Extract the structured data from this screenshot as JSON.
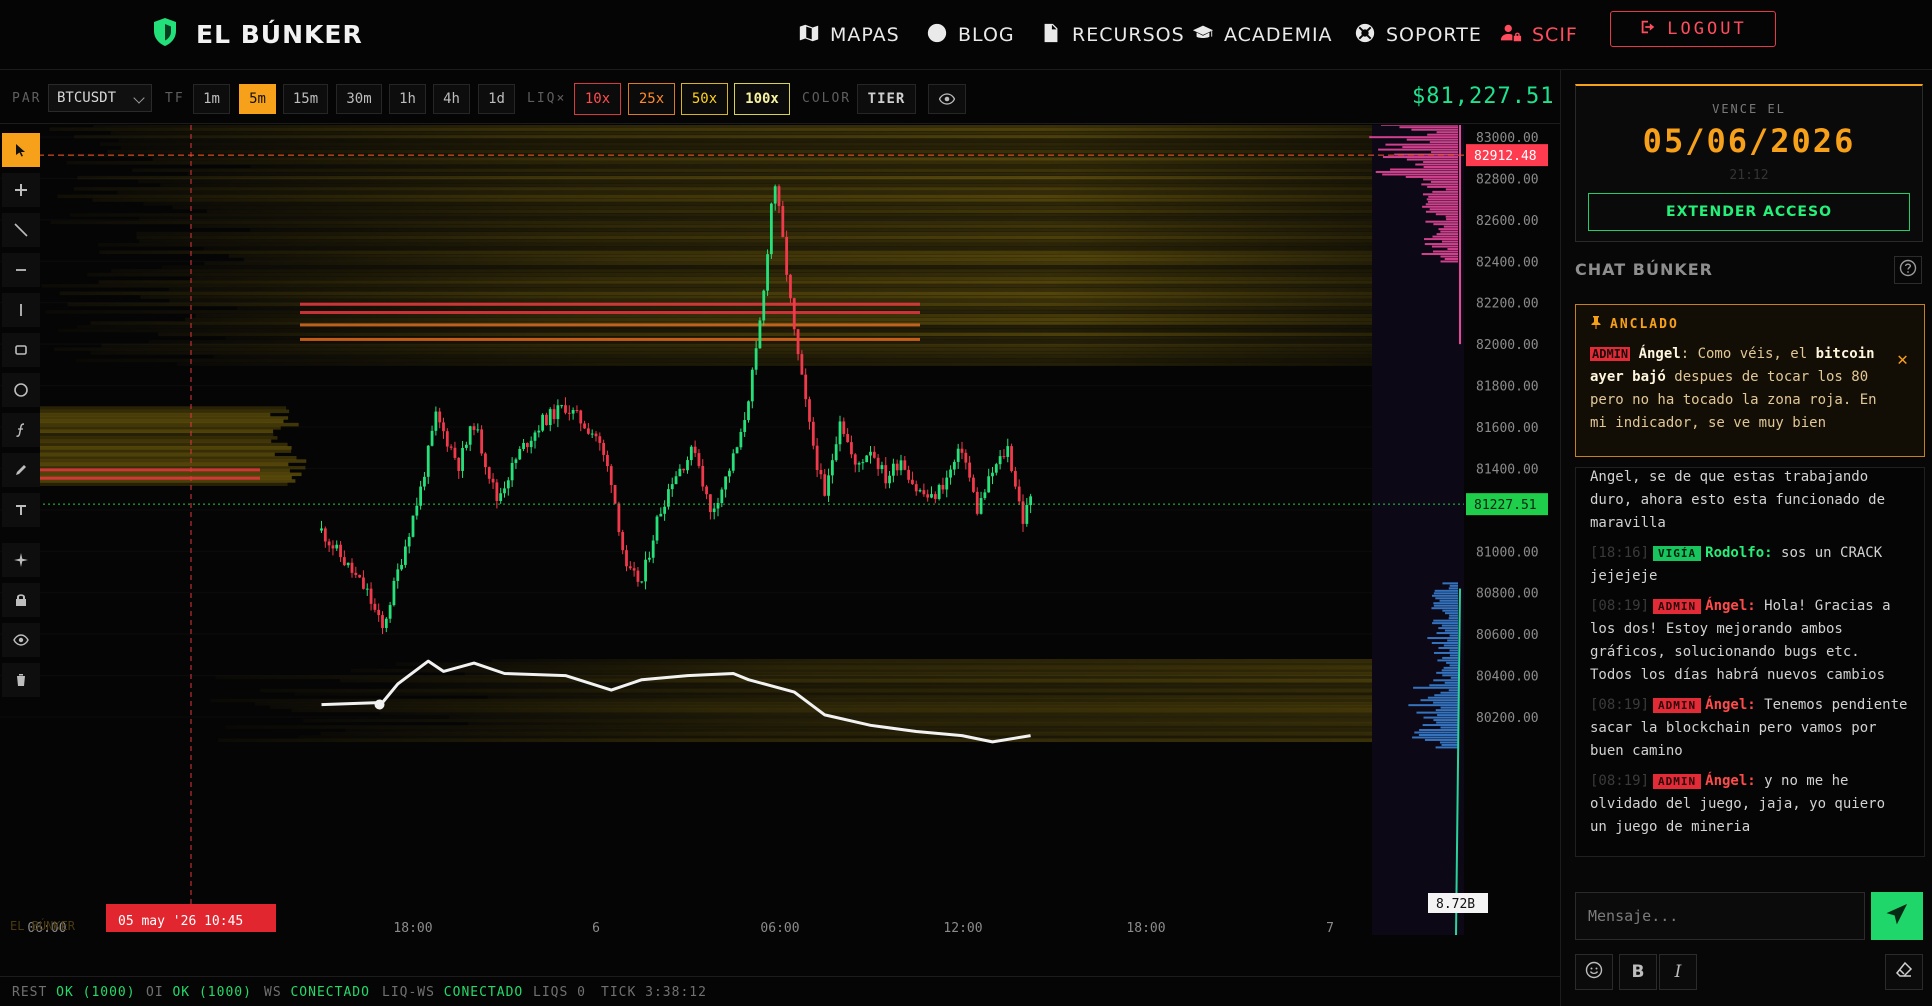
{
  "header": {
    "brand": "EL BÚNKER",
    "nav": [
      {
        "label": "MAPAS",
        "icon": "map-icon"
      },
      {
        "label": "BLOG",
        "icon": "globe-icon"
      },
      {
        "label": "RECURSOS",
        "icon": "document-icon"
      },
      {
        "label": "ACADEMIA",
        "icon": "graduation-cap-icon"
      },
      {
        "label": "SOPORTE",
        "icon": "lifebuoy-icon"
      },
      {
        "label": "SCIF",
        "icon": "user-lock-icon"
      }
    ],
    "logout": "LOGOUT"
  },
  "toolbar": {
    "pair_label": "PAR",
    "pair_value": "BTCUSDT",
    "tf_label": "TF",
    "timeframes": [
      "1m",
      "5m",
      "15m",
      "30m",
      "1h",
      "4h",
      "1d"
    ],
    "active_timeframe": "5m",
    "liq_label": "LIQ×",
    "leverages": [
      "10x",
      "25x",
      "50x",
      "100x"
    ],
    "color_label": "COLOR",
    "tier_label": "TIER",
    "last_price": "$81,227.51"
  },
  "chart_data": {
    "type": "candlestick",
    "symbol": "BTCUSDT",
    "timeframe": "5m",
    "ylim": [
      80100,
      83150
    ],
    "y_ticks": [
      "83000.00",
      "82800.00",
      "82600.00",
      "82400.00",
      "82200.00",
      "82000.00",
      "81800.00",
      "81600.00",
      "81400.00",
      "81200.00",
      "81000.00",
      "80800.00",
      "80600.00",
      "80400.00",
      "80200.00"
    ],
    "x_ticks": [
      "06:00",
      "18:00",
      "6",
      "06:00",
      "12:00",
      "18:00",
      "7"
    ],
    "cursor_label": "05 may '26   10:45",
    "current_price_label": "81227.51",
    "current_price": 81227.51,
    "high_marker_label": "82912.48",
    "high_marker": 82912.48,
    "volume_label": "8.72B",
    "watermark": "EL BÚNKER",
    "close_path": [
      [
        "05 06:00",
        81100
      ],
      [
        "05 07:30",
        80950
      ],
      [
        "05 09:00",
        80800
      ],
      [
        "05 10:00",
        80620
      ],
      [
        "05 11:00",
        80900
      ],
      [
        "05 12:30",
        81300
      ],
      [
        "05 13:30",
        81650
      ],
      [
        "05 15:00",
        81420
      ],
      [
        "05 16:00",
        81620
      ],
      [
        "05 17:30",
        81250
      ],
      [
        "05 19:00",
        81480
      ],
      [
        "05 20:30",
        81630
      ],
      [
        "05 22:00",
        81700
      ],
      [
        "06 00:00",
        81560
      ],
      [
        "06 01:00",
        81350
      ],
      [
        "06 02:00",
        80900
      ],
      [
        "06 03:00",
        80850
      ],
      [
        "06 04:00",
        81150
      ],
      [
        "06 05:00",
        81350
      ],
      [
        "06 06:30",
        81500
      ],
      [
        "06 07:30",
        81180
      ],
      [
        "06 08:30",
        81350
      ],
      [
        "06 09:30",
        81550
      ],
      [
        "06 10:30",
        81950
      ],
      [
        "06 11:00",
        82250
      ],
      [
        "06 11:40",
        82820
      ],
      [
        "06 12:20",
        82450
      ],
      [
        "06 13:00",
        82050
      ],
      [
        "06 14:00",
        81600
      ],
      [
        "06 15:00",
        81250
      ],
      [
        "06 16:00",
        81650
      ],
      [
        "06 17:00",
        81400
      ],
      [
        "06 18:00",
        81500
      ],
      [
        "06 19:00",
        81350
      ],
      [
        "06 20:00",
        81450
      ],
      [
        "06 21:00",
        81300
      ],
      [
        "06 22:00",
        81250
      ],
      [
        "06 23:00",
        81350
      ],
      [
        "07 00:00",
        81500
      ],
      [
        "07 01:00",
        81200
      ],
      [
        "07 02:00",
        81380
      ],
      [
        "07 03:00",
        81500
      ],
      [
        "07 04:00",
        81150
      ],
      [
        "07 04:30",
        81250
      ]
    ],
    "oi_path": [
      [
        "05 06:00",
        80260
      ],
      [
        "05 10:00",
        80270
      ],
      [
        "05 11:00",
        80360
      ],
      [
        "05 13:00",
        80470
      ],
      [
        "05 14:00",
        80420
      ],
      [
        "05 16:00",
        80460
      ],
      [
        "05 18:00",
        80410
      ],
      [
        "05 22:00",
        80400
      ],
      [
        "06 01:00",
        80330
      ],
      [
        "06 03:00",
        80380
      ],
      [
        "06 06:00",
        80400
      ],
      [
        "06 09:00",
        80410
      ],
      [
        "06 10:00",
        80380
      ],
      [
        "06 13:00",
        80320
      ],
      [
        "06 15:00",
        80210
      ],
      [
        "06 18:00",
        80160
      ],
      [
        "06 21:00",
        80130
      ],
      [
        "07 00:00",
        80110
      ],
      [
        "07 02:00",
        80080
      ],
      [
        "07 04:30",
        80110
      ]
    ],
    "colors": {
      "up": "#26e07a",
      "down": "#f0394b",
      "oi_line": "#f2f2f2",
      "liquidity": "#c9a611",
      "high_marker": "#ff3b4f",
      "price_marker": "#1fce4a"
    }
  },
  "status": {
    "rest_label": "REST",
    "rest_value": "OK (1000)",
    "oi_label": "OI",
    "oi_value": "OK (1000)",
    "ws_label": "WS",
    "ws_value": "CONECTADO",
    "liqws_label": "LIQ-WS",
    "liqws_value": "CONECTADO",
    "liqs": "LIQS 0",
    "tick": "TICK 3:38:12"
  },
  "panel": {
    "expiry_label": "VENCE EL",
    "expiry_date": "05/06/2026",
    "expiry_time": "21:12",
    "extend_label": "EXTENDER ACCESO",
    "chat_title": "CHAT BÚNKER",
    "pinned": {
      "header": "ANCLADO",
      "badge": "ADMIN",
      "author": "Ángel",
      "text_1": ": Como véis, el ",
      "bold": "bitcoin ayer bajó",
      "text_2": " despues de tocar los 80 pero no ha tocado la zona roja. En mi indicador, se ve muy bien"
    },
    "messages": [
      {
        "time": "",
        "badge": "",
        "author": "",
        "text": "Angel, se de que estas trabajando duro, ahora esto esta funcionado de maravilla"
      },
      {
        "time": "[18:16]",
        "badge": "VIGÍA",
        "author": "Rodolfo:",
        "text": "sos un CRACK jejejeje"
      },
      {
        "time": "[08:19]",
        "badge": "ADMIN",
        "author": "Ángel:",
        "text": "Hola! Gracias a los dos! Estoy mejorando ambos gráficos, solucionando bugs etc. Todos los días habrá nuevos cambios"
      },
      {
        "time": "[08:19]",
        "badge": "ADMIN",
        "author": "Ángel:",
        "text": "Tenemos pendiente sacar la blockchain pero vamos por buen camino"
      },
      {
        "time": "[08:19]",
        "badge": "ADMIN",
        "author": "Ángel:",
        "text": "y no me he olvidado del juego, jaja, yo quiero un juego de mineria"
      }
    ],
    "input_placeholder": "Mensaje...",
    "bold_label": "B",
    "italic_label": "I"
  }
}
